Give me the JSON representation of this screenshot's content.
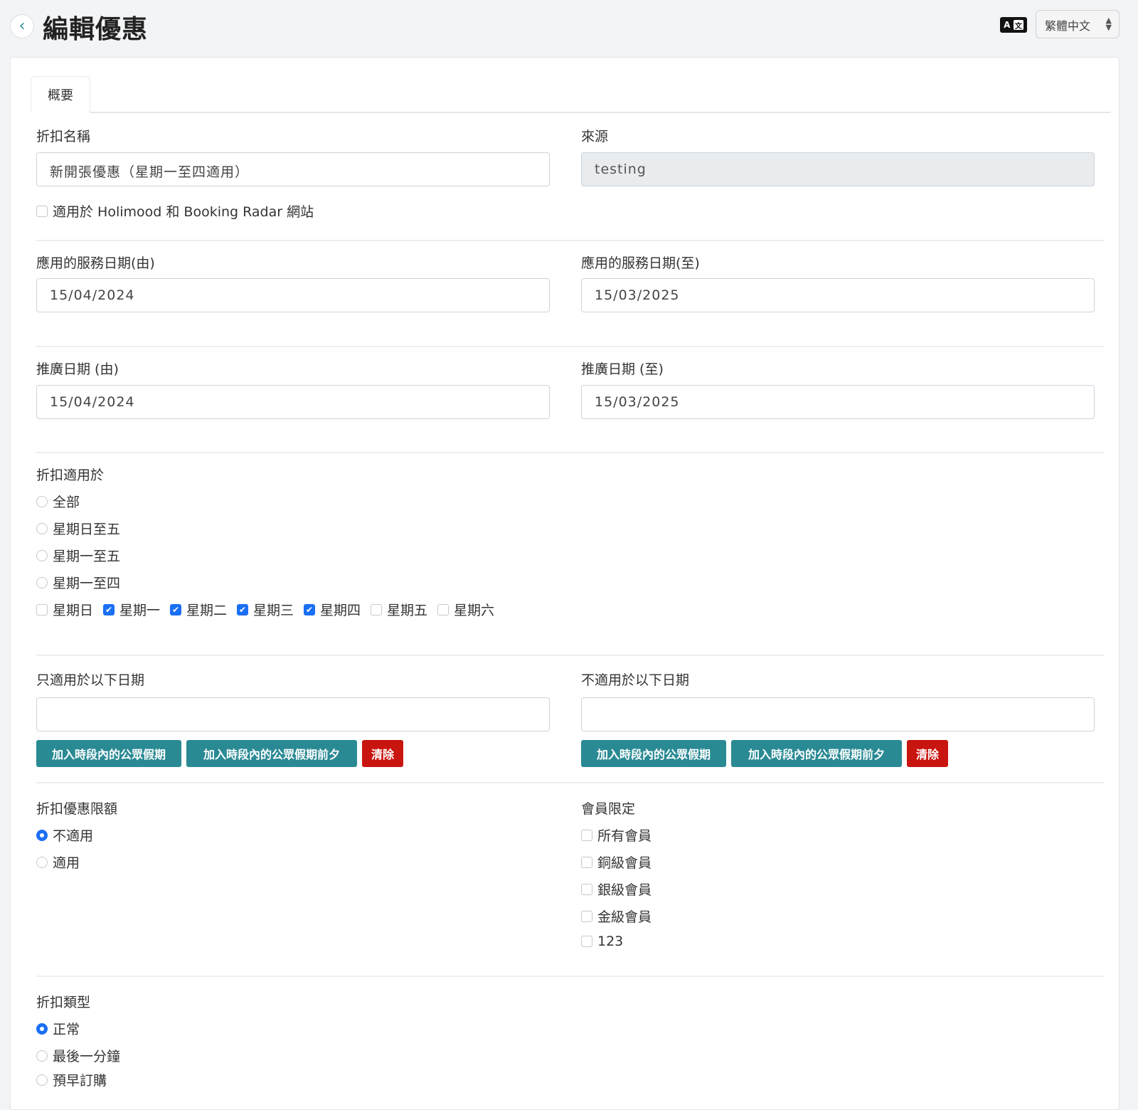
{
  "header": {
    "title": "編輯優惠",
    "back_icon": "chevron-left-icon",
    "lang_icon_a": "A",
    "lang_icon_b": "文",
    "language_selected": "繁體中文"
  },
  "tabs": [
    {
      "label": "概要",
      "active": true
    }
  ],
  "form": {
    "discount_name": {
      "label": "折扣名稱",
      "value": "新開張優惠（星期一至四適用）"
    },
    "source": {
      "label": "來源",
      "value": "testing"
    },
    "holimood_checkbox": {
      "label": "適用於 Holimood 和 Booking Radar 網站",
      "checked": false
    },
    "service_date_from": {
      "label": "應用的服務日期(由)",
      "value": "15/04/2024"
    },
    "service_date_to": {
      "label": "應用的服務日期(至)",
      "value": "15/03/2025"
    },
    "promo_date_from": {
      "label": "推廣日期 (由)",
      "value": "15/04/2024"
    },
    "promo_date_to": {
      "label": "推廣日期 (至)",
      "value": "15/03/2025"
    },
    "applies_to": {
      "label": "折扣適用於",
      "radios": [
        {
          "label": "全部",
          "checked": false
        },
        {
          "label": "星期日至五",
          "checked": false
        },
        {
          "label": "星期一至五",
          "checked": false
        },
        {
          "label": "星期一至四",
          "checked": false
        }
      ],
      "days": [
        {
          "label": "星期日",
          "checked": false
        },
        {
          "label": "星期一",
          "checked": true
        },
        {
          "label": "星期二",
          "checked": true
        },
        {
          "label": "星期三",
          "checked": true
        },
        {
          "label": "星期四",
          "checked": true
        },
        {
          "label": "星期五",
          "checked": false
        },
        {
          "label": "星期六",
          "checked": false
        }
      ]
    },
    "only_dates": {
      "label": "只適用於以下日期",
      "value": ""
    },
    "exclude_dates": {
      "label": "不適用於以下日期",
      "value": ""
    },
    "buttons": {
      "add_holidays": "加入時段內的公眾假期",
      "add_holiday_eves": "加入時段內的公眾假期前夕",
      "clear": "清除"
    },
    "limit": {
      "label": "折扣優惠限額",
      "radios": [
        {
          "label": "不適用",
          "checked": true
        },
        {
          "label": "適用",
          "checked": false
        }
      ]
    },
    "membership": {
      "label": "會員限定",
      "checkboxes": [
        {
          "label": "所有會員",
          "checked": false
        },
        {
          "label": "銅級會員",
          "checked": false
        },
        {
          "label": "銀級會員",
          "checked": false
        },
        {
          "label": "金級會員",
          "checked": false
        },
        {
          "label": "123",
          "checked": false
        }
      ]
    },
    "discount_type": {
      "label": "折扣類型",
      "radios": [
        {
          "label": "正常",
          "checked": true
        },
        {
          "label": "最後一分鐘",
          "checked": false
        },
        {
          "label": "預早訂購",
          "checked": false
        }
      ]
    }
  },
  "colors": {
    "accent": "#1a6ff5",
    "teal_button": "#2a8a94",
    "danger_button": "#c9150f"
  }
}
